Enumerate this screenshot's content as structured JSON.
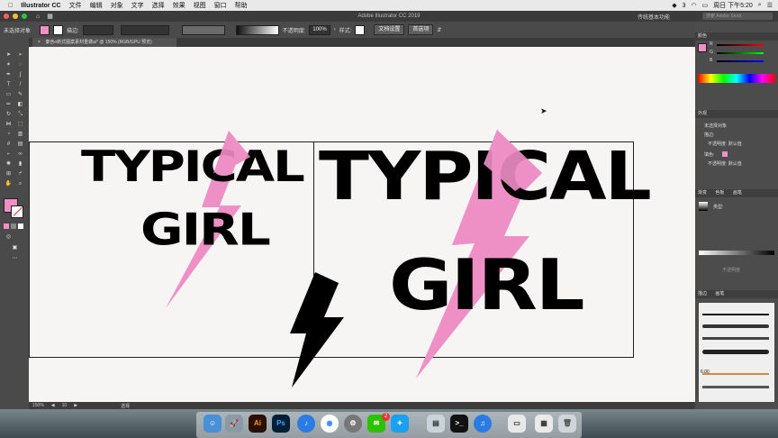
{
  "menubar": {
    "app_name": "Illustrator CC",
    "items": [
      "文件",
      "编辑",
      "对象",
      "文字",
      "选择",
      "效果",
      "视图",
      "窗口",
      "帮助"
    ],
    "clock": "周日 下午5:20",
    "notif_count": "3"
  },
  "titlebar": {
    "title": "Adobe Illustrator CC 2019",
    "workspace": "传统基本功能",
    "search_placeholder": "搜索 Adobe Stock"
  },
  "controlbar": {
    "selection_label": "未选择对象",
    "stroke_label": "描边:",
    "opacity_label": "不透明度:",
    "opacity_value": "100%",
    "style_label": "样式:",
    "doc_setup": "文档设置",
    "preferences": "首选项"
  },
  "tab": {
    "label": "秦含o新式图案素材重做ai* @ 150% (RGB/GPU 预览)",
    "close": "×"
  },
  "artwork": {
    "left_line1": "TYPICAL",
    "left_line2": "GIRL",
    "right_line1": "TYPICAL",
    "right_line2": "GIRL"
  },
  "statusbar": {
    "zoom": "150%",
    "page": "10",
    "mode": "选择"
  },
  "colors": {
    "pink": "#ee8fc6",
    "black": "#000000",
    "canvas": "#f7f4f4"
  },
  "panels": {
    "color_tab": "颜色",
    "color_labels": [
      "R",
      "G",
      "B"
    ],
    "appearance_tab": "外观",
    "appearance_title": "未选择对象",
    "stroke_row": "描边:",
    "opacity_row": "不透明度: 默认值",
    "fill_row": "填色:",
    "opacity_row2": "不透明度: 默认值",
    "gradient_tabs": [
      "渐变",
      "色板",
      "画笔"
    ],
    "gradient_type": "类型:",
    "transparency_tab": "不透明度",
    "brush_tabs": [
      "描边",
      "画笔"
    ],
    "brush_size": "6.00"
  },
  "dock": {
    "icons": [
      "finder-icon",
      "rocket-icon",
      "illustrator-icon",
      "photoshop-icon",
      "music-icon",
      "chrome-icon",
      "system-preferences-icon",
      "wechat-icon",
      "qq-icon",
      "scanner-icon",
      "terminal-icon",
      "itunes-icon",
      "display-icon",
      "image-capture-icon",
      "trash-icon"
    ],
    "ai_label": "Ai",
    "ps_label": "Ps",
    "wechat_badge": "2"
  }
}
